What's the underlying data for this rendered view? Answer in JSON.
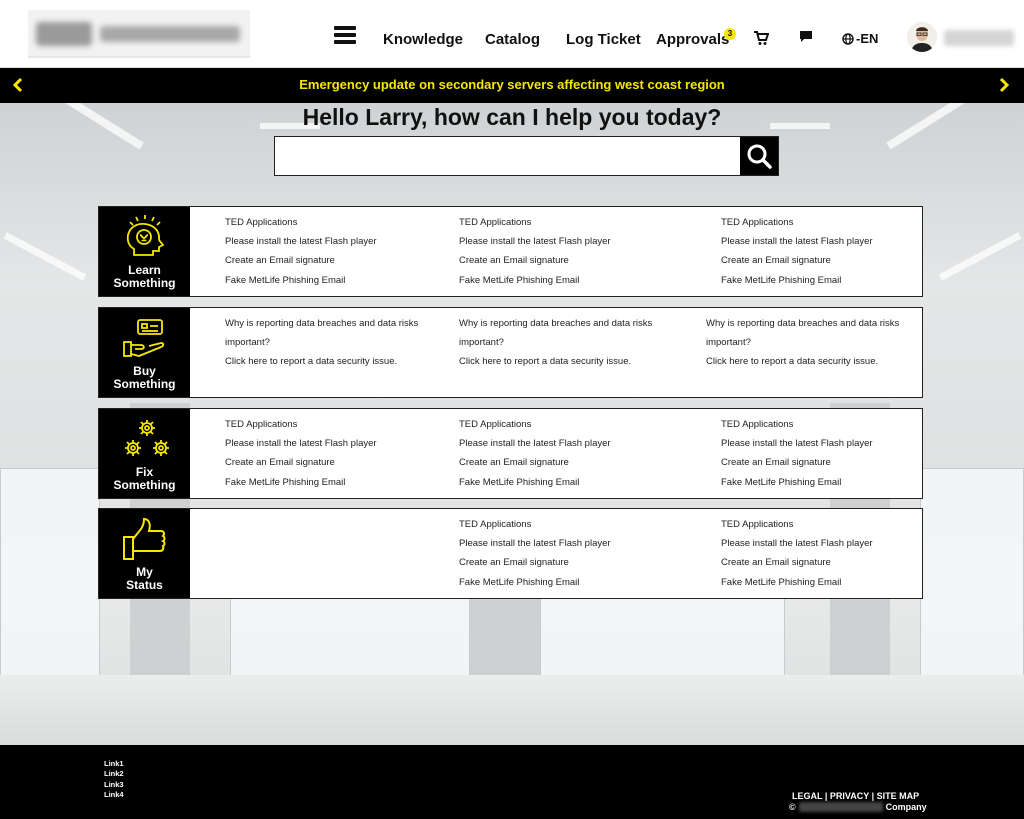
{
  "header": {
    "nav": [
      "Knowledge",
      "Catalog",
      "Log Ticket",
      "Approvals"
    ],
    "approvals_badge": "3",
    "language": "-EN"
  },
  "announcement": {
    "text": "Emergency update on secondary servers affecting west coast region"
  },
  "hero": {
    "greeting": "Hello Larry, how can I help you today?",
    "search_placeholder": ""
  },
  "colors": {
    "accent": "#f5e700",
    "dark": "#000000"
  },
  "panels": [
    {
      "label_line1": "Learn",
      "label_line2": "Something",
      "icon": "brain-head-icon",
      "columns": [
        [
          "TED Applications",
          "Please install the latest Flash player",
          "Create an Email signature",
          "Fake MetLife Phishing Email"
        ],
        [
          "TED Applications",
          "Please install the latest Flash player",
          "Create an Email signature",
          "Fake MetLife Phishing Email"
        ],
        [
          "TED Applications",
          "Please install the latest Flash player",
          "Create an Email signature",
          "Fake MetLife Phishing Email"
        ]
      ]
    },
    {
      "label_line1": "Buy",
      "label_line2": "Something",
      "icon": "hand-card-icon",
      "columns": [
        [
          "Why is reporting data breaches and data risks important?",
          "Click here to report a data security issue."
        ],
        [
          "Why is reporting data breaches and data risks important?",
          "Click here to report a data security issue."
        ],
        [
          "Why is reporting data breaches and data risks important?",
          "Click here to report a data security issue."
        ]
      ]
    },
    {
      "label_line1": "Fix",
      "label_line2": "Something",
      "icon": "gears-icon",
      "columns": [
        [
          "TED Applications",
          "Please install the latest Flash player",
          "Create an Email signature",
          "Fake MetLife Phishing Email"
        ],
        [
          "TED Applications",
          "Please install the latest Flash player",
          "Create an Email signature",
          "Fake MetLife Phishing Email"
        ],
        [
          "TED Applications",
          "Please install the latest Flash player",
          "Create an Email signature",
          "Fake MetLife Phishing Email"
        ]
      ]
    },
    {
      "label_line1": "My",
      "label_line2": "Status",
      "icon": "thumbs-up-icon",
      "columns": [
        [],
        [
          "TED Applications",
          "Please install the latest Flash player",
          "Create an Email signature",
          "Fake MetLife Phishing Email"
        ],
        [
          "TED Applications",
          "Please install the latest Flash player",
          "Create an Email signature",
          "Fake MetLife Phishing Email"
        ]
      ]
    }
  ],
  "footer": {
    "links": [
      "Link1",
      "Link2",
      "Link3",
      "Link4"
    ],
    "legal": "LEGAL",
    "privacy": "PRIVACY",
    "sitemap": "SITE MAP",
    "copyright_symbol": "©",
    "company": "Company"
  }
}
